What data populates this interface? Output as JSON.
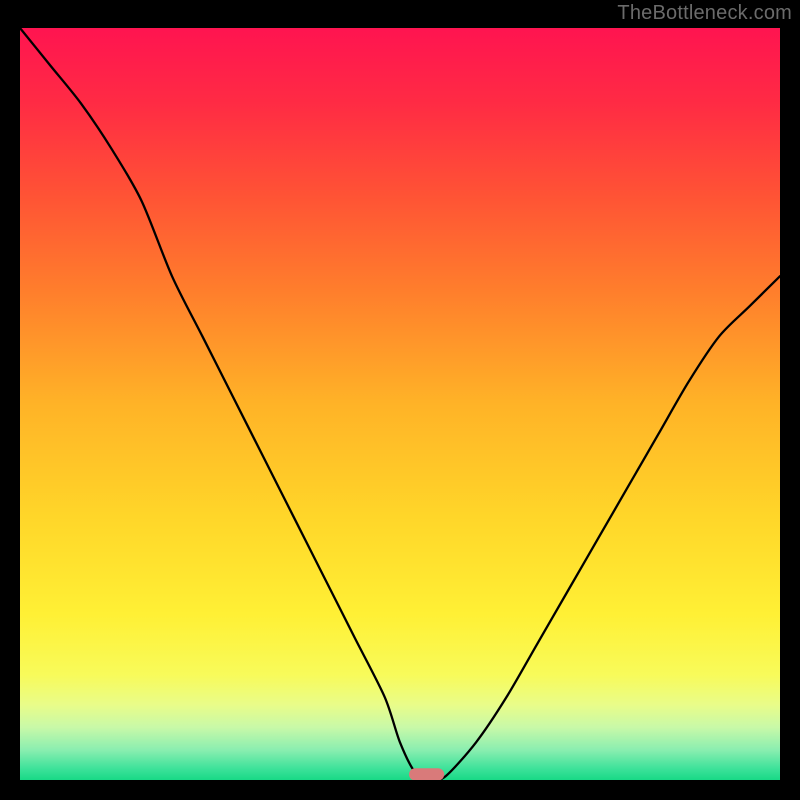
{
  "watermark": "TheBottleneck.com",
  "gradient": {
    "stops": [
      {
        "offset": 0.0,
        "color": "#ff1450"
      },
      {
        "offset": 0.1,
        "color": "#ff2b44"
      },
      {
        "offset": 0.22,
        "color": "#ff5235"
      },
      {
        "offset": 0.35,
        "color": "#ff7e2c"
      },
      {
        "offset": 0.5,
        "color": "#ffb327"
      },
      {
        "offset": 0.65,
        "color": "#ffd629"
      },
      {
        "offset": 0.78,
        "color": "#fff035"
      },
      {
        "offset": 0.86,
        "color": "#f8fb5a"
      },
      {
        "offset": 0.9,
        "color": "#e9fc89"
      },
      {
        "offset": 0.93,
        "color": "#c8f9a8"
      },
      {
        "offset": 0.96,
        "color": "#8aeeb0"
      },
      {
        "offset": 0.985,
        "color": "#3de29a"
      },
      {
        "offset": 1.0,
        "color": "#18d986"
      }
    ]
  },
  "chart_data": {
    "type": "line",
    "title": "",
    "xlabel": "",
    "ylabel": "",
    "xlim": [
      0,
      100
    ],
    "ylim": [
      0,
      100
    ],
    "series": [
      {
        "name": "bottleneck-curve",
        "x": [
          0,
          4,
          8,
          12,
          16,
          20,
          24,
          28,
          32,
          36,
          40,
          44,
          48,
          50,
          52,
          54,
          56,
          60,
          64,
          68,
          72,
          76,
          80,
          84,
          88,
          92,
          96,
          100
        ],
        "y": [
          100,
          95,
          90,
          84,
          77,
          67,
          59,
          51,
          43,
          35,
          27,
          19,
          11,
          5,
          1,
          0,
          0.5,
          5,
          11,
          18,
          25,
          32,
          39,
          46,
          53,
          59,
          63,
          67
        ]
      }
    ],
    "marker": {
      "x": 53.5,
      "y": 0,
      "width": 4.5,
      "height": 1.5
    },
    "legend": null,
    "grid": false
  }
}
